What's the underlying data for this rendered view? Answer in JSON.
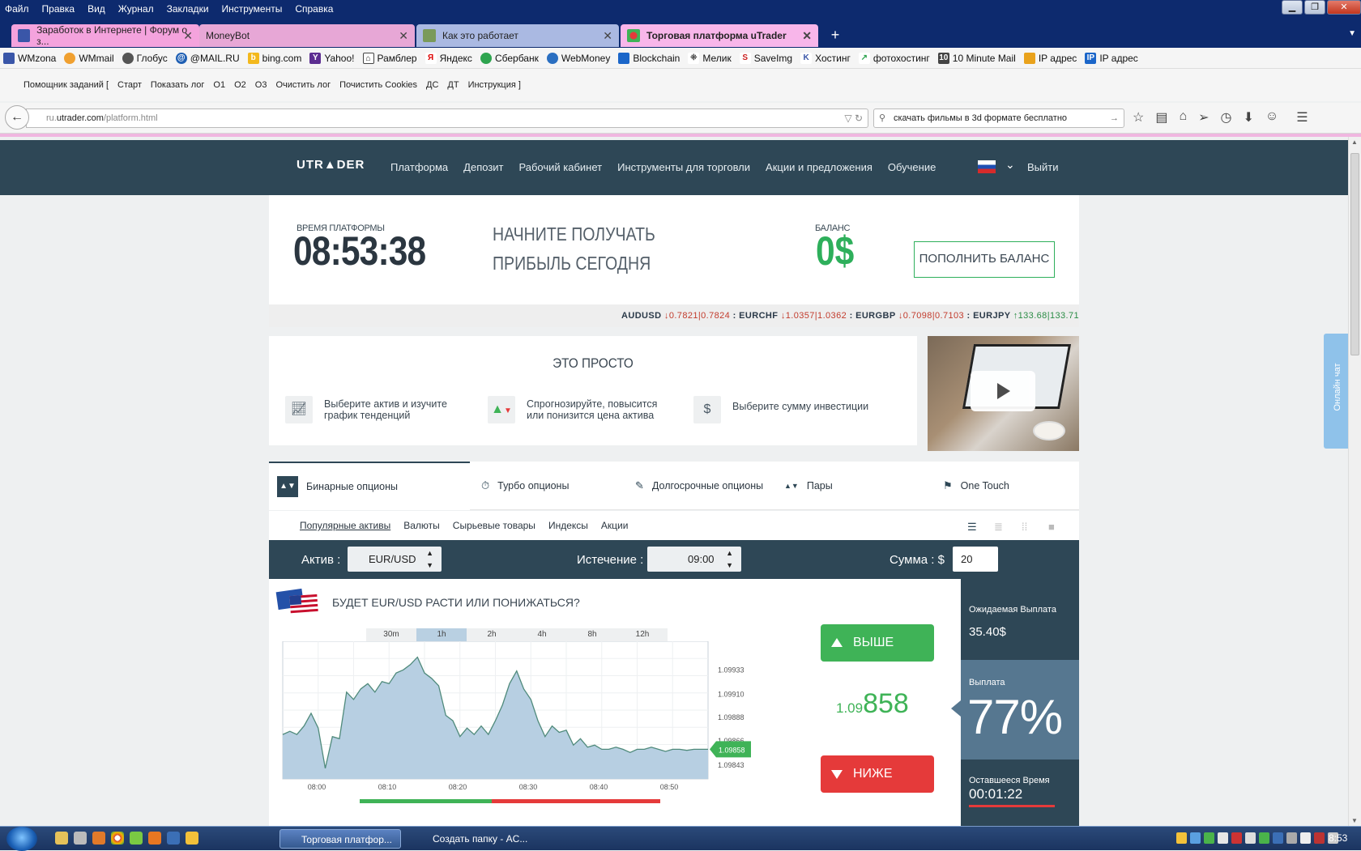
{
  "menu": [
    "Файл",
    "Правка",
    "Вид",
    "Журнал",
    "Закладки",
    "Инструменты",
    "Справка"
  ],
  "tabs": [
    {
      "label": "Заработок в Интернете | Форум о з...",
      "color": "#f4a3dd"
    },
    {
      "label": "MoneyBot",
      "color": "#e7a7d6"
    },
    {
      "label": "Как это работает",
      "color": "#aab9e2"
    },
    {
      "label": "Торговая платформа uTrader",
      "color": "#f8b6ea"
    }
  ],
  "bookmarks": [
    "WMzona",
    "WMmail",
    "Глобус",
    "@MAIL.RU",
    "bing.com",
    "Yahoo!",
    "Рамблер",
    "Яндекс",
    "Сбербанк",
    "WebMoney",
    "Blockchain",
    "Мелик",
    "SaveImg",
    "Хостинг",
    "фотохостинг",
    "10 Minute Mail",
    "IP адрес",
    "IP адрес"
  ],
  "helper": {
    "title": "Помощник заданий [",
    "items": [
      "Старт",
      "Показать лог",
      "O1",
      "O2",
      "O3",
      "Очистить лог",
      "Почистить Cookies",
      "ДС",
      "ДТ",
      "Инструкция ]"
    ]
  },
  "address": {
    "prefix": "ru.",
    "host": "utrader.com",
    "path": "/platform.html"
  },
  "search": {
    "value": "скачать фильмы в 3d формате бесплатно"
  },
  "site": {
    "logo": "UTR▲DER",
    "nav": [
      "Платформа",
      "Депозит",
      "Рабочий кабинет",
      "Инструменты для торговли",
      "Акции и предложения",
      "Обучение"
    ],
    "logout": "Выйти",
    "time_label": "ВРЕМЯ ПЛАТФОРМЫ",
    "time": "08:53:38",
    "promo_line1": "НАЧНИТЕ ПОЛУЧАТЬ",
    "promo_line2": "ПРИБЫЛЬ СЕГОДНЯ",
    "balance_label": "БАЛАНС",
    "balance": "0$",
    "topup": "ПОПОЛНИТЬ БАЛАНС"
  },
  "ticker": [
    {
      "pair": "AUDUSD",
      "dir": "↓",
      "v": "0.7821|0.7824",
      "cls": "dn"
    },
    {
      "pair": "EURCHF",
      "dir": "↓",
      "v": "1.0357|1.0362",
      "cls": "dn"
    },
    {
      "pair": "EURGBP",
      "dir": "↓",
      "v": "0.7098|0.7103",
      "cls": "dn"
    },
    {
      "pair": "EURJPY",
      "dir": "↑",
      "v": "133.68|133.71",
      "cls": "up"
    }
  ],
  "simple": {
    "title": "ЭТО ПРОСТО",
    "step1_a": "Выберите актив и изучите",
    "step1_b": "график тенденций",
    "step2_a": "Спрогнозируйте, повысится",
    "step2_b": "или понизится цена актива",
    "step3": "Выберите сумму инвестиции"
  },
  "option_tabs": [
    "Бинарные опционы",
    "Турбо опционы",
    "Долгосрочные опционы",
    "Пары",
    "One Touch"
  ],
  "sub_tabs": [
    "Популярные активы",
    "Валюты",
    "Сырьевые товары",
    "Индексы",
    "Акции"
  ],
  "controls": {
    "asset_label": "Актив :",
    "asset": "EUR/USD",
    "expiry_label": "Истечение :",
    "expiry": "09:00",
    "amount_label": "Сумма : $",
    "amount": "20"
  },
  "question": "БУДЕТ EUR/USD РАСТИ ИЛИ ПОНИЖАТЬСЯ?",
  "timeframes": [
    "30m",
    "1h",
    "2h",
    "4h",
    "8h",
    "12h"
  ],
  "active_timeframe": "1h",
  "chart_data": {
    "type": "area",
    "x_ticks": [
      "08:00",
      "08:10",
      "08:20",
      "08:30",
      "08:40",
      "08:50"
    ],
    "y_ticks": [
      "1.09933",
      "1.09910",
      "1.09888",
      "1.09866",
      "1.09843"
    ],
    "ylim": [
      1.0983,
      1.0996
    ],
    "x": [
      0,
      1,
      2,
      3,
      4,
      5,
      6,
      7,
      8,
      9,
      10,
      11,
      12,
      13,
      14,
      15,
      16,
      17,
      18,
      19,
      20,
      21,
      22,
      23,
      24,
      25,
      26,
      27,
      28,
      29,
      30,
      31,
      32,
      33,
      34,
      35,
      36,
      37,
      38,
      39,
      40,
      41,
      42,
      43,
      44,
      45,
      46,
      47,
      48,
      49,
      50,
      51,
      52,
      53,
      54,
      55,
      56,
      57,
      58,
      59,
      60
    ],
    "values": [
      1.09872,
      1.09875,
      1.09872,
      1.0988,
      1.09892,
      1.09878,
      1.0984,
      1.0987,
      1.09868,
      1.09912,
      1.09905,
      1.09915,
      1.0992,
      1.09912,
      1.09922,
      1.0992,
      1.0993,
      1.09933,
      1.09938,
      1.09945,
      1.0993,
      1.09925,
      1.09918,
      1.0989,
      1.09885,
      1.0987,
      1.09878,
      1.09872,
      1.0988,
      1.09872,
      1.09885,
      1.099,
      1.0992,
      1.09932,
      1.09915,
      1.09905,
      1.09885,
      1.0987,
      1.0988,
      1.09874,
      1.09876,
      1.09862,
      1.09868,
      1.0986,
      1.09862,
      1.09858,
      1.09858,
      1.0986,
      1.09858,
      1.09855,
      1.09858,
      1.09858,
      1.0986,
      1.09858,
      1.09856,
      1.09858,
      1.09858,
      1.09857,
      1.09858,
      1.09858,
      1.09858
    ],
    "current": "1.09858"
  },
  "buy": {
    "up": "ВЫШЕ",
    "down": "НИЖЕ",
    "price_small": "1.09",
    "price_big": "858"
  },
  "right": {
    "expected_label": "Ожидаемая Выплата",
    "expected": "35.40$",
    "payout_label": "Выплата",
    "payout": "77%",
    "remaining_label": "Оставшееся Время",
    "remaining": "00:01:22"
  },
  "chat": "Онлайн чат",
  "taskbar": {
    "task1": "Торговая платфор...",
    "task2": "Создать папку - AC...",
    "time": "8:53"
  }
}
